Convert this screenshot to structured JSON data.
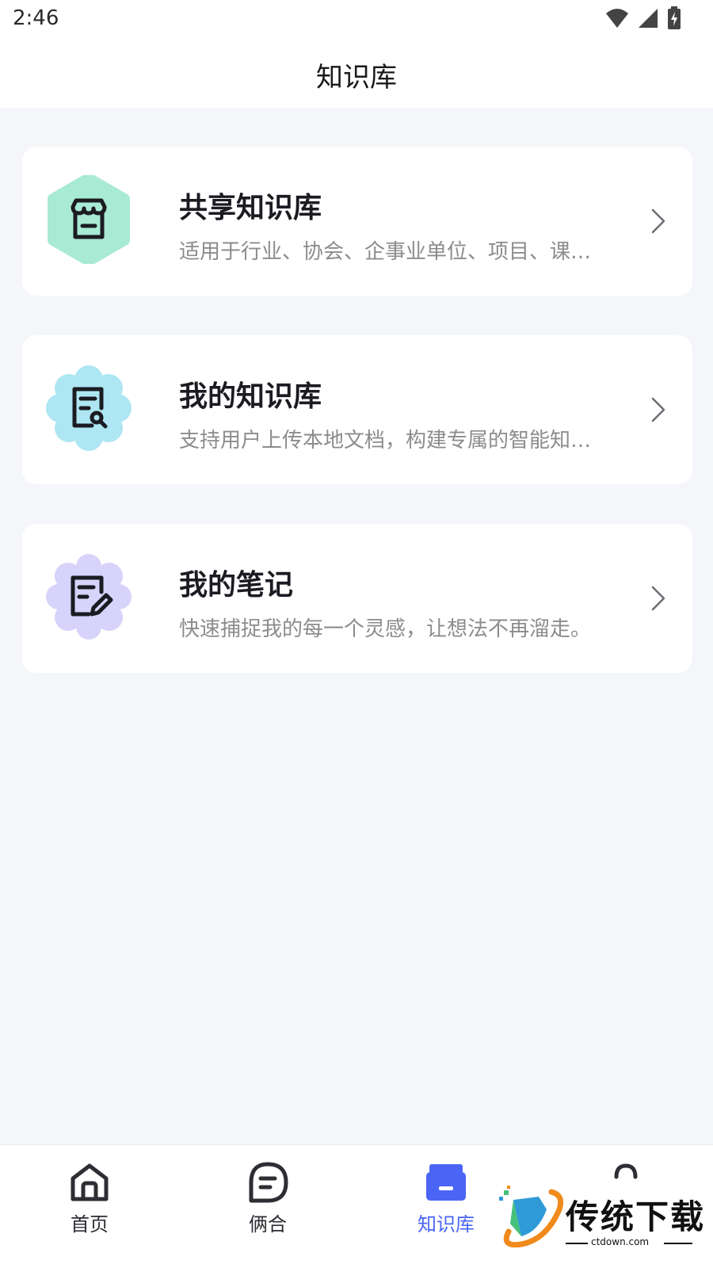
{
  "status_bar": {
    "time": "2:46",
    "icons": [
      "wifi-icon",
      "signal-icon",
      "battery-charging-icon"
    ]
  },
  "header": {
    "title": "知识库"
  },
  "cards": [
    {
      "title": "共享知识库",
      "description": "适用于行业、协会、企事业单位、项目、课…",
      "icon": "store-icon",
      "icon_bg": "#a8ead3"
    },
    {
      "title": "我的知识库",
      "description": "支持用户上传本地文档，构建专属的智能知…",
      "icon": "document-search-icon",
      "icon_bg": "#aee6f3"
    },
    {
      "title": "我的笔记",
      "description": "快速捕捉我的每一个灵感，让想法不再溜走。",
      "icon": "note-edit-icon",
      "icon_bg": "#d7d3fb"
    }
  ],
  "tab_bar": {
    "items": [
      {
        "label": "首页",
        "icon": "home-icon",
        "active": false
      },
      {
        "label": "俩合",
        "icon": "chat-icon",
        "active": false
      },
      {
        "label": "知识库",
        "icon": "knowledge-base-icon",
        "active": true
      },
      {
        "label": "",
        "icon": "profile-icon",
        "active": false
      }
    ]
  },
  "watermark": {
    "text": "传统下载",
    "sub": "ctdown.com"
  },
  "colors": {
    "accent": "#4a65f5",
    "background": "#f5f6fa",
    "text_primary": "#1b1c22",
    "text_secondary": "#8c8c8c"
  }
}
